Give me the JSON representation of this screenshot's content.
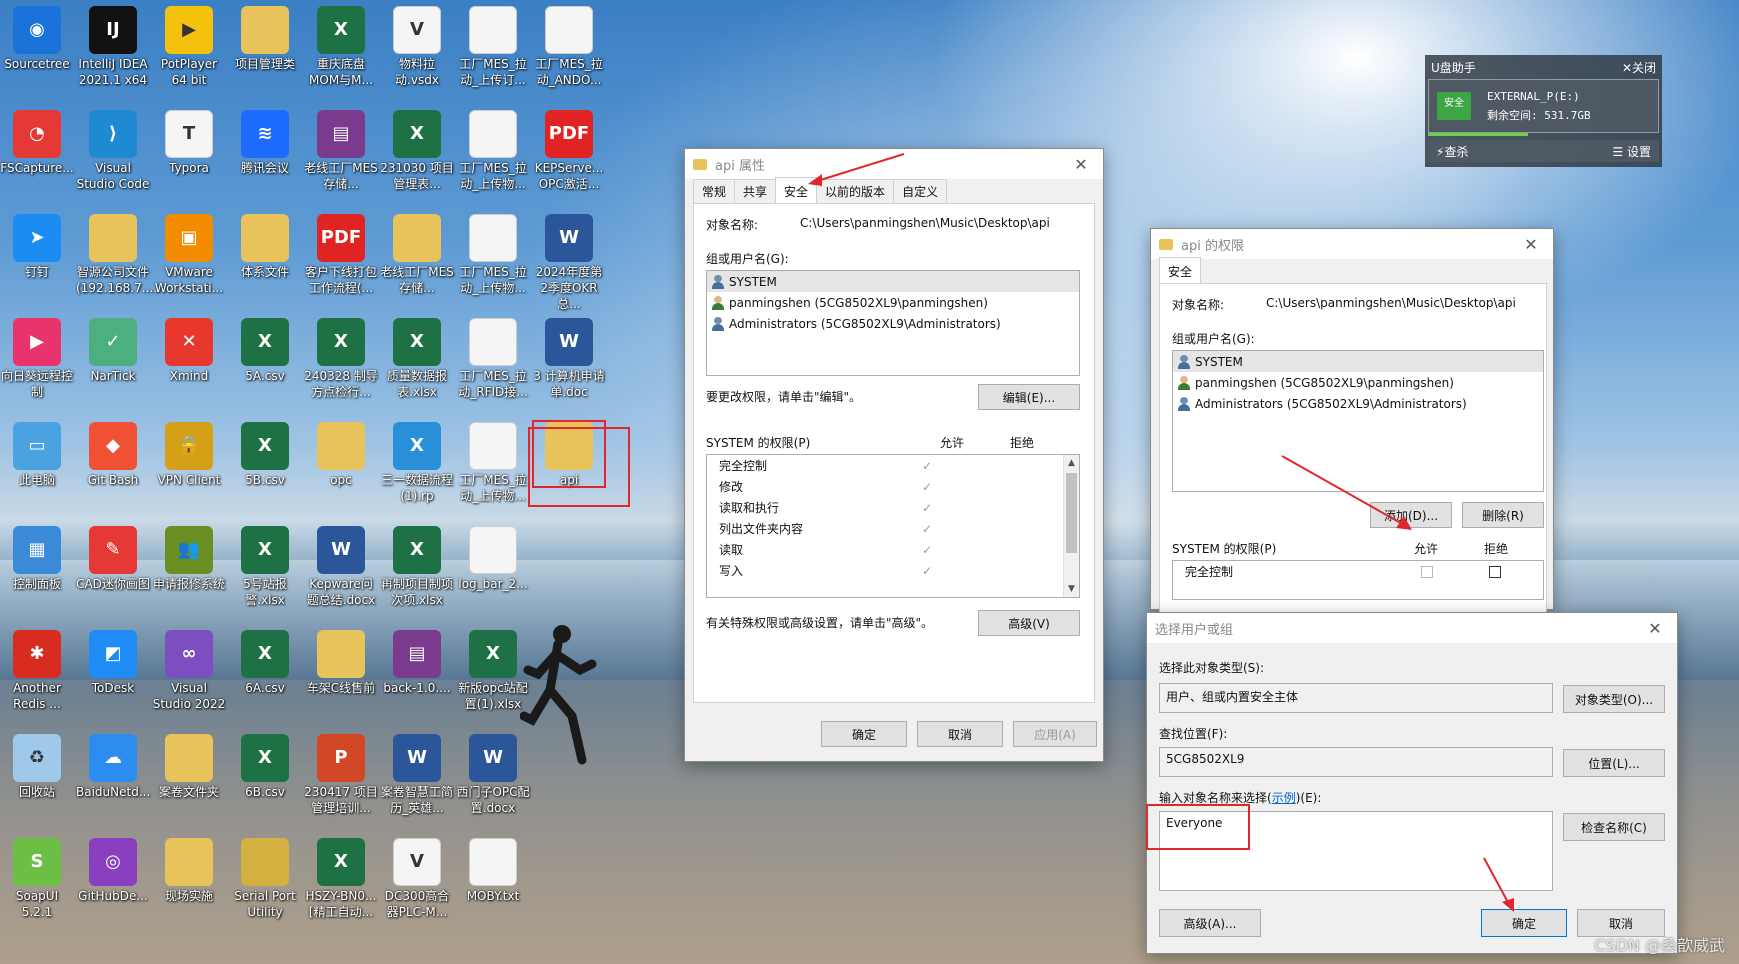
{
  "desktop": {
    "icons": [
      {
        "label": "Sourcetree",
        "icon": "sourcetree-icon",
        "color": "#1a73d9",
        "glyph": "◉"
      },
      {
        "label": "IntelliJ IDEA 2021.1 x64",
        "icon": "intellij-icon",
        "color": "#111111",
        "glyph": "IJ"
      },
      {
        "label": "PotPlayer 64 bit",
        "icon": "potplayer-icon",
        "color": "#f4c20d",
        "glyph": "▶"
      },
      {
        "label": "项目管理类",
        "icon": "folder-icon",
        "color": "#e8c25a",
        "glyph": ""
      },
      {
        "label": "重庆底盘 MOM与M...",
        "icon": "excel-icon",
        "color": "#1e7145",
        "glyph": "X"
      },
      {
        "label": "物料拉动.vsdx",
        "icon": "visio-icon",
        "color": "#f5f5f5",
        "glyph": "V"
      },
      {
        "label": "工厂MES_拉动_上传订...",
        "icon": "document-icon",
        "color": "#f5f5f5",
        "glyph": ""
      },
      {
        "label": "工厂MES_拉动_ANDO...",
        "icon": "document-icon",
        "color": "#f5f5f5",
        "glyph": ""
      },
      {
        "label": "FSCapture...",
        "icon": "fscapture-icon",
        "color": "#e53935",
        "glyph": "◔"
      },
      {
        "label": "Visual Studio Code",
        "icon": "vscode-icon",
        "color": "#1f8ad2",
        "glyph": "⟩"
      },
      {
        "label": "Typora",
        "icon": "typora-icon",
        "color": "#f5f5f5",
        "glyph": "T"
      },
      {
        "label": "腾讯会议",
        "icon": "tencent-meeting-icon",
        "color": "#1e6bff",
        "glyph": "≋"
      },
      {
        "label": "老线工厂MES存储...",
        "icon": "winrar-icon",
        "color": "#7a3b8f",
        "glyph": "▤"
      },
      {
        "label": "231030 项目管理表...",
        "icon": "excel-icon",
        "color": "#1e7145",
        "glyph": "X"
      },
      {
        "label": "工厂MES_拉动_上传物...",
        "icon": "document-icon",
        "color": "#f5f5f5",
        "glyph": ""
      },
      {
        "label": "KEPServe... OPC激活...",
        "icon": "pdf-icon",
        "color": "#e02424",
        "glyph": "PDF"
      },
      {
        "label": "钉钉",
        "icon": "dingtalk-icon",
        "color": "#1b8cf2",
        "glyph": "➤"
      },
      {
        "label": "智源公司文件 (192.168.7....",
        "icon": "folder-icon",
        "color": "#e8c25a",
        "glyph": ""
      },
      {
        "label": "VMware Workstati...",
        "icon": "vmware-icon",
        "color": "#f38b00",
        "glyph": "▣"
      },
      {
        "label": "体系文件",
        "icon": "folder-icon",
        "color": "#e8c25a",
        "glyph": ""
      },
      {
        "label": "客户下线打包工作流程(...",
        "icon": "pdf-icon",
        "color": "#e02424",
        "glyph": "PDF"
      },
      {
        "label": "老线工厂MES存储...",
        "icon": "folder-icon",
        "color": "#e8c25a",
        "glyph": ""
      },
      {
        "label": "工厂MES_拉动_上传物...",
        "icon": "document-icon",
        "color": "#f5f5f5",
        "glyph": ""
      },
      {
        "label": "2024年度第2季度OKR总...",
        "icon": "word-icon",
        "color": "#2b579a",
        "glyph": "W"
      },
      {
        "label": "向日葵远程控制",
        "icon": "sunlogin-icon",
        "color": "#e8336d",
        "glyph": "▶"
      },
      {
        "label": "NarTick",
        "icon": "nartick-icon",
        "color": "#4caf82",
        "glyph": "✓"
      },
      {
        "label": "Xmind",
        "icon": "xmind-icon",
        "color": "#e8372c",
        "glyph": "✕"
      },
      {
        "label": "5A.csv",
        "icon": "excel-csv-icon",
        "color": "#1e7145",
        "glyph": "X"
      },
      {
        "label": "240328 制导方点检行...",
        "icon": "excel-icon",
        "color": "#1e7145",
        "glyph": "X"
      },
      {
        "label": "质量数据报表.xlsx",
        "icon": "excel-icon",
        "color": "#1e7145",
        "glyph": "X"
      },
      {
        "label": "工厂MES_拉动_RFID接...",
        "icon": "document-icon",
        "color": "#f5f5f5",
        "glyph": ""
      },
      {
        "label": "3 计算机申请单.doc",
        "icon": "word-icon",
        "color": "#2b579a",
        "glyph": "W"
      },
      {
        "label": "此电脑",
        "icon": "this-pc-icon",
        "color": "#4aa3e0",
        "glyph": "▭"
      },
      {
        "label": "Git Bash",
        "icon": "git-bash-icon",
        "color": "#f05033",
        "glyph": "◆"
      },
      {
        "label": "VPN Client",
        "icon": "vpn-client-icon",
        "color": "#d4a017",
        "glyph": "🔒"
      },
      {
        "label": "5B.csv",
        "icon": "excel-csv-icon",
        "color": "#1e7145",
        "glyph": "X"
      },
      {
        "label": "opc",
        "icon": "folder-icon",
        "color": "#e8c25a",
        "glyph": ""
      },
      {
        "label": "三一数据流程(1).rp",
        "icon": "axure-icon",
        "color": "#2a8fd9",
        "glyph": "X"
      },
      {
        "label": "工厂MES_拉动_上传物...",
        "icon": "document-icon",
        "color": "#f5f5f5",
        "glyph": ""
      },
      {
        "label": "api",
        "icon": "folder-icon",
        "color": "#e8c25a",
        "glyph": ""
      },
      {
        "label": "控制面板",
        "icon": "control-panel-icon",
        "color": "#3a8ad8",
        "glyph": "▦"
      },
      {
        "label": "CAD迷你画图",
        "icon": "cad-mini-icon",
        "color": "#e53935",
        "glyph": "✎"
      },
      {
        "label": "申请报修系统",
        "icon": "users-icon",
        "color": "#6b8e23",
        "glyph": "👥"
      },
      {
        "label": "5号站报警.xlsx",
        "icon": "excel-icon",
        "color": "#1e7145",
        "glyph": "X"
      },
      {
        "label": "Kepware问题总结.docx",
        "icon": "word-icon",
        "color": "#2b579a",
        "glyph": "W"
      },
      {
        "label": "再制项目制项次项.xlsx",
        "icon": "excel-icon",
        "color": "#1e7145",
        "glyph": "X"
      },
      {
        "label": "log_bar_2...",
        "icon": "document-icon",
        "color": "#f5f5f5",
        "glyph": ""
      },
      {
        "label": "",
        "icon": "",
        "color": "",
        "glyph": ""
      },
      {
        "label": "Another Redis ...",
        "icon": "redis-icon",
        "color": "#d82c20",
        "glyph": "✱"
      },
      {
        "label": "ToDesk",
        "icon": "todesk-icon",
        "color": "#1f8bf5",
        "glyph": "◩"
      },
      {
        "label": "Visual Studio 2022",
        "icon": "visual-studio-icon",
        "color": "#7b4fbf",
        "glyph": "∞"
      },
      {
        "label": "6A.csv",
        "icon": "excel-csv-icon",
        "color": "#1e7145",
        "glyph": "X"
      },
      {
        "label": "车架C线售前",
        "icon": "folder-icon",
        "color": "#e8c25a",
        "glyph": ""
      },
      {
        "label": "back-1.0....",
        "icon": "winrar-icon",
        "color": "#7a3b8f",
        "glyph": "▤"
      },
      {
        "label": "新版opc站配置(1).xlsx",
        "icon": "excel-icon",
        "color": "#1e7145",
        "glyph": "X"
      },
      {
        "label": "",
        "icon": "",
        "color": "",
        "glyph": ""
      },
      {
        "label": "回收站",
        "icon": "recycle-bin-icon",
        "color": "#9ec9ea",
        "glyph": "♻"
      },
      {
        "label": "BaiduNetd...",
        "icon": "baidu-netdisk-icon",
        "color": "#2d8cf0",
        "glyph": "☁"
      },
      {
        "label": "案卷文件夹",
        "icon": "folder-icon",
        "color": "#e8c25a",
        "glyph": ""
      },
      {
        "label": "6B.csv",
        "icon": "excel-csv-icon",
        "color": "#1e7145",
        "glyph": "X"
      },
      {
        "label": "230417 项目管理培训...",
        "icon": "powerpoint-icon",
        "color": "#d24726",
        "glyph": "P"
      },
      {
        "label": "案卷智慧工简历_英雄...",
        "icon": "word-icon",
        "color": "#2b579a",
        "glyph": "W"
      },
      {
        "label": "西门子OPC配置.docx",
        "icon": "word-icon",
        "color": "#2b579a",
        "glyph": "W"
      },
      {
        "label": "",
        "icon": "",
        "color": "",
        "glyph": ""
      },
      {
        "label": "SoapUI 5.2.1",
        "icon": "soapui-icon",
        "color": "#6cbe45",
        "glyph": "S"
      },
      {
        "label": "GitHubDe...",
        "icon": "github-desktop-icon",
        "color": "#8a3fbf",
        "glyph": "◎"
      },
      {
        "label": "现场实施",
        "icon": "folder-icon",
        "color": "#e8c25a",
        "glyph": ""
      },
      {
        "label": "Serial Port Utility",
        "icon": "folder-icon",
        "color": "#d4b040",
        "glyph": ""
      },
      {
        "label": "HSZY-BN0... [精工自动...",
        "icon": "excel-icon",
        "color": "#1e7145",
        "glyph": "X"
      },
      {
        "label": "DC300高合器PLC-M...",
        "icon": "visio-icon",
        "color": "#f5f5f5",
        "glyph": "V"
      },
      {
        "label": "MOBY.txt",
        "icon": "document-icon",
        "color": "#f5f5f5",
        "glyph": ""
      },
      {
        "label": "",
        "icon": "",
        "color": "",
        "glyph": ""
      }
    ]
  },
  "udisk": {
    "title": "U盘助手",
    "close": "✕关闭",
    "badge": "安全",
    "drive": "EXTERNAL_P(E:)",
    "free": "剩余空间: 531.7GB",
    "eject": "查杀",
    "settings": "设置"
  },
  "properties": {
    "title": "api 属性",
    "tabs": [
      "常规",
      "共享",
      "安全",
      "以前的版本",
      "自定义"
    ],
    "object_label": "对象名称:",
    "object_value": "C:\\Users\\panmingshen\\Music\\Desktop\\api",
    "group_label": "组或用户名(G):",
    "users": [
      "SYSTEM",
      "panmingshen (5CG8502XL9\\panmingshen)",
      "Administrators (5CG8502XL9\\Administrators)"
    ],
    "edit_hint": "要更改权限，请单击\"编辑\"。",
    "edit_button": "编辑(E)...",
    "perm_label": "SYSTEM 的权限(P)",
    "allow": "允许",
    "deny": "拒绝",
    "perms": [
      "完全控制",
      "修改",
      "读取和执行",
      "列出文件夹内容",
      "读取",
      "写入"
    ],
    "advanced_hint": "有关特殊权限或高级设置，请单击\"高级\"。",
    "advanced_button": "高级(V)",
    "ok": "确定",
    "cancel": "取消",
    "apply": "应用(A)"
  },
  "permissions": {
    "title": "api 的权限",
    "tab": "安全",
    "object_label": "对象名称:",
    "object_value": "C:\\Users\\panmingshen\\Music\\Desktop\\api",
    "group_label": "组或用户名(G):",
    "users": [
      "SYSTEM",
      "panmingshen (5CG8502XL9\\panmingshen)",
      "Administrators (5CG8502XL9\\Administrators)"
    ],
    "add_button": "添加(D)...",
    "remove_button": "删除(R)",
    "perm_label": "SYSTEM 的权限(P)",
    "allow": "允许",
    "deny": "拒绝",
    "perm_row": "完全控制"
  },
  "select_user": {
    "title": "选择用户或组",
    "type_label": "选择此对象类型(S):",
    "type_value": "用户、组或内置安全主体",
    "type_button": "对象类型(O)...",
    "location_label": "查找位置(F):",
    "location_value": "5CG8502XL9",
    "location_button": "位置(L)...",
    "enter_label_prefix": "输入对象名称来选择(",
    "enter_label_link": "示例",
    "enter_label_suffix": ")(E):",
    "enter_value": "Everyone",
    "check_button": "检查名称(C)",
    "advanced_button": "高级(A)...",
    "ok": "确定",
    "cancel": "取消"
  },
  "watermark": "CSDN @桑歆威武"
}
